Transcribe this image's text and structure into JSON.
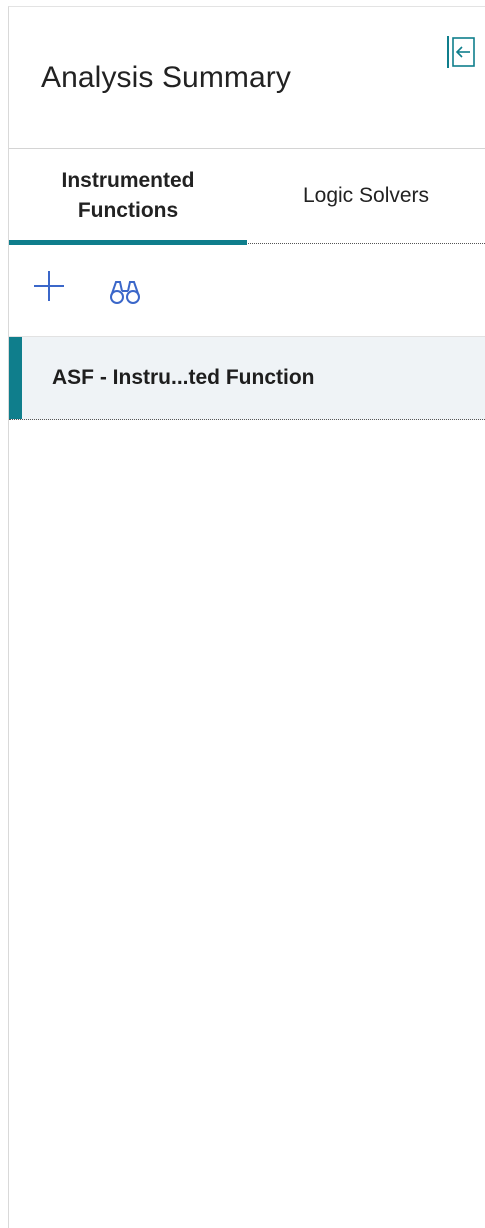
{
  "header": {
    "title": "Analysis Summary",
    "collapse_icon": "collapse-panel-left-icon"
  },
  "tabs": [
    {
      "label": "Instrumented\nFunctions",
      "active": true
    },
    {
      "label": "Logic Solvers",
      "active": false
    }
  ],
  "toolbar": {
    "add_icon": "plus-icon",
    "search_icon": "binoculars-icon"
  },
  "list": {
    "items": [
      {
        "label": "ASF - Instru...ted Function",
        "selected": true
      }
    ]
  },
  "colors": {
    "accent": "#0f7e8c",
    "icon_blue": "#3b67c9",
    "selected_bg": "#eff3f6"
  }
}
